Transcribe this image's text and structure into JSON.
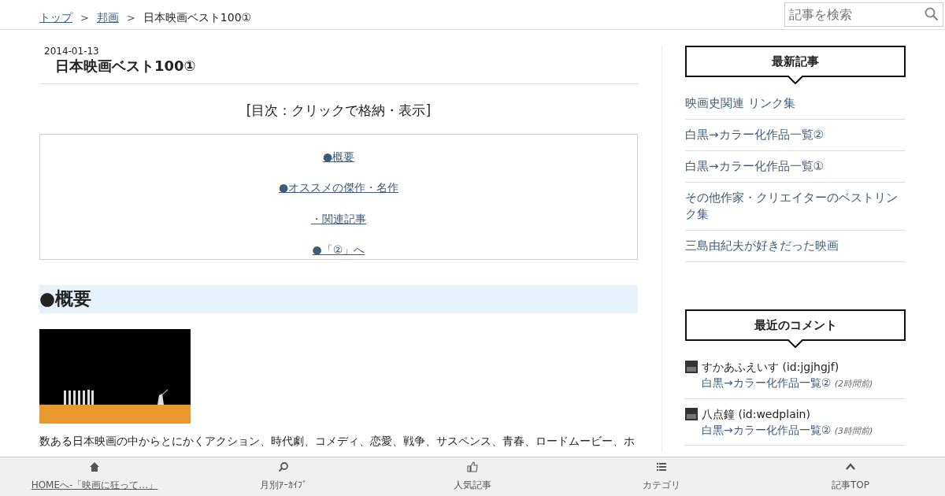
{
  "breadcrumb_separator": ">",
  "breadcrumb": [
    {
      "label": "トップ",
      "kind": "link"
    },
    {
      "label": "邦画",
      "kind": "link"
    },
    {
      "label": "日本映画ベスト100①",
      "kind": "current"
    }
  ],
  "search": {
    "placeholder": "記事を検索"
  },
  "article": {
    "date": "2014-01-13",
    "title": "日本映画ベスト100①",
    "toc_title": "[目次：クリックで格納・表示]",
    "toc": [
      "●概要",
      "●オススメの傑作・名作",
      "・関連記事",
      "●「②」へ"
    ],
    "section_heading": "●概要",
    "image": {
      "kind": "picture"
    },
    "paragraph": "数ある日本映画の中からとにかくアクション、時代劇、コメディ、恋愛、戦争、サスペンス、青春、ロードムービー、ホ"
  },
  "sidebar": {
    "recent_title": "最新記事",
    "recent": [
      "映画史関連 リンク集",
      "白黒→カラー化作品一覧②",
      "白黒→カラー化作品一覧①",
      "その他作家・クリエイターのベストリンク集",
      "三島由紀夫が好きだった映画"
    ],
    "comments_title": "最近のコメント",
    "comments": [
      {
        "user": "すかあふえいす (id:jgjhgjf)",
        "link": "白黒→カラー化作品一覧②",
        "time": "(2時間前)"
      },
      {
        "user": "八点鐘 (id:wedplain)",
        "link": "白黒→カラー化作品一覧②",
        "time": "(3時間前)"
      }
    ]
  },
  "bottom_bar": [
    {
      "label": "HOMEへ-「映画に狂って…」",
      "kind": "home"
    },
    {
      "label": "月別ｱｰｶｲﾌﾞ",
      "kind": "search"
    },
    {
      "label": "人気記事",
      "kind": "thumb"
    },
    {
      "label": "カテゴリ",
      "kind": "list"
    },
    {
      "label": "記事TOP",
      "kind": "top"
    }
  ]
}
